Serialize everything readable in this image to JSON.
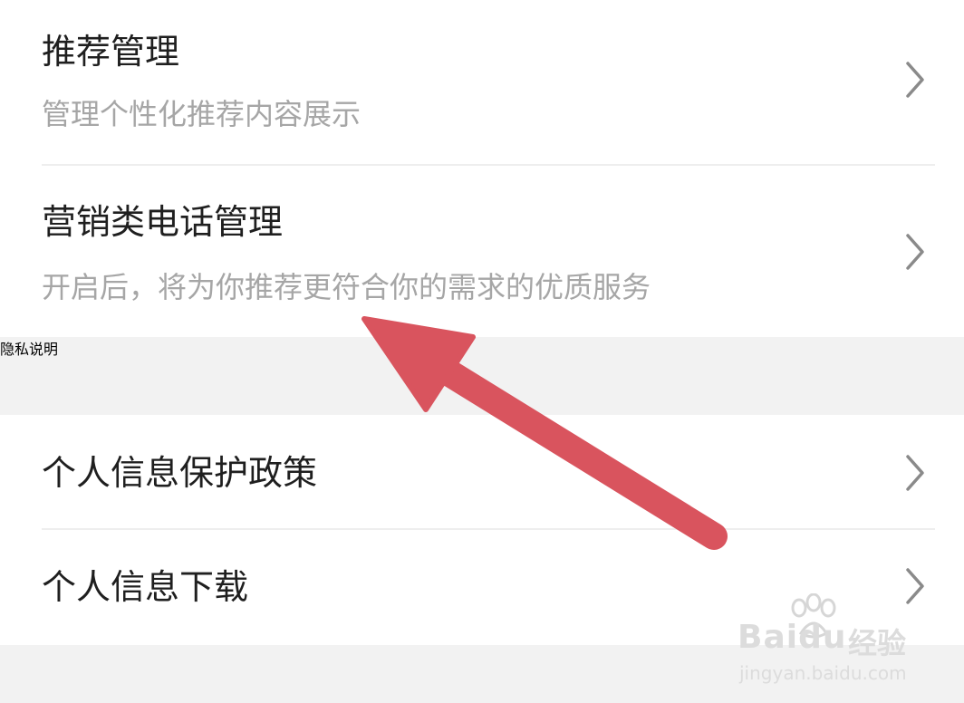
{
  "items": [
    {
      "title": "推荐管理",
      "desc": "管理个性化推荐内容展示"
    },
    {
      "title": "营销类电话管理",
      "desc": "开启后，将为你推荐更符合你的需求的优质服务"
    }
  ],
  "privacy_section": {
    "header": "隐私说明",
    "items": [
      {
        "title": "个人信息保护政策"
      },
      {
        "title": "个人信息下载"
      }
    ]
  },
  "watermark": {
    "brand": "Baidu",
    "brand_suffix": "经验",
    "url": "jingyan.baidu.com"
  },
  "colors": {
    "arrow": "#d9545e",
    "title_text": "#1f1f1f",
    "desc_text": "#a6a6a6",
    "section_bg": "#f2f2f2"
  }
}
